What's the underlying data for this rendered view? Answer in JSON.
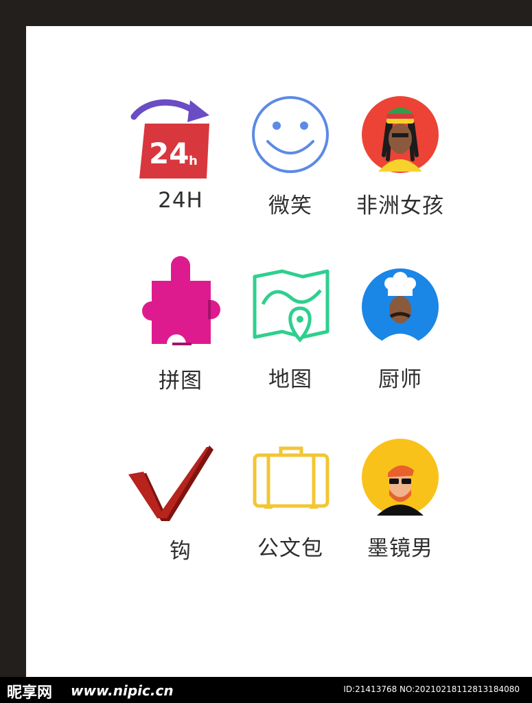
{
  "icons": [
    {
      "label": "24H",
      "icon": "24h-icon",
      "badge_text": "24",
      "badge_sub": "h"
    },
    {
      "label": "微笑",
      "icon": "smile-icon"
    },
    {
      "label": "非洲女孩",
      "icon": "african-girl-avatar-icon"
    },
    {
      "label": "拼图",
      "icon": "puzzle-piece-icon"
    },
    {
      "label": "地图",
      "icon": "map-pin-icon"
    },
    {
      "label": "厨师",
      "icon": "chef-avatar-icon"
    },
    {
      "label": "钩",
      "icon": "checkmark-icon"
    },
    {
      "label": "公文包",
      "icon": "briefcase-icon"
    },
    {
      "label": "墨镜男",
      "icon": "sunglasses-man-avatar-icon"
    }
  ],
  "colors": {
    "frame": "#231f1c",
    "badge_red": "#d8373d",
    "arrow_purple": "#6a4cc4",
    "smile_blue": "#5c8ae6",
    "girl_bg": "#ec4336",
    "puzzle_pink": "#de1b8e",
    "map_green": "#2fcf8e",
    "chef_bg": "#1a86e6",
    "check_red": "#b7231d",
    "briefcase_yellow": "#f2c634",
    "sunglasses_bg": "#f8c21a"
  },
  "watermark": {
    "logo": "昵享网",
    "site": "www.nipic.cn",
    "id": "ID:21413768 NO:20210218112813184080"
  }
}
